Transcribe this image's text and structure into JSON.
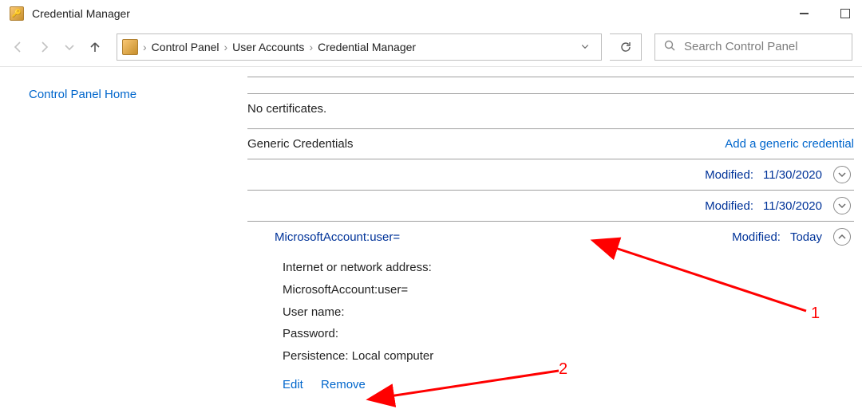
{
  "window": {
    "title": "Credential Manager"
  },
  "breadcrumb": {
    "parts": [
      "Control Panel",
      "User Accounts",
      "Credential Manager"
    ]
  },
  "search": {
    "placeholder": "Search Control Panel"
  },
  "sidebar": {
    "home_link": "Control Panel Home"
  },
  "sections": {
    "no_cert_text": "No certificates.",
    "generic_header": "Generic Credentials",
    "add_generic_link": "Add a generic credential",
    "modified_label": "Modified:",
    "rows": [
      {
        "date": "11/30/2020"
      },
      {
        "date": "11/30/2020"
      }
    ],
    "expanded": {
      "name": "MicrosoftAccount:user=",
      "date": "Today",
      "addr_label": "Internet or network address:",
      "addr_value": "MicrosoftAccount:user=",
      "user_label": "User name:",
      "pass_label": "Password:",
      "persist_full": "Persistence:  Local computer",
      "edit": "Edit",
      "remove": "Remove"
    }
  },
  "annotations": {
    "n1": "1",
    "n2": "2"
  }
}
